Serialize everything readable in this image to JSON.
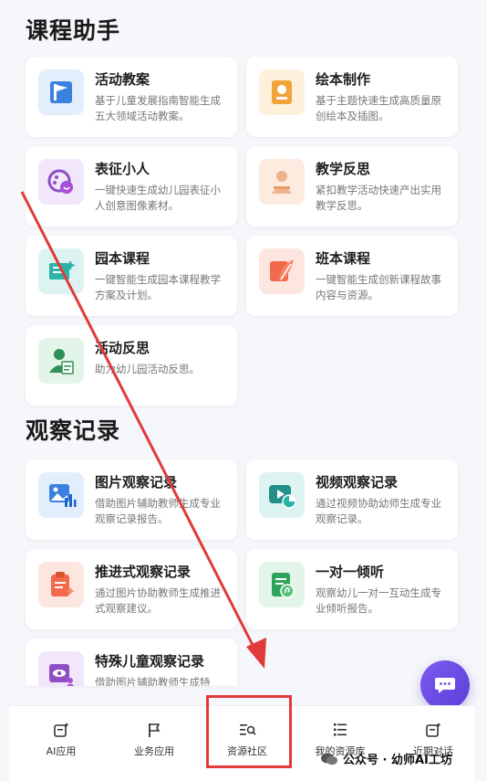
{
  "sections": {
    "course_assistant": "课程助手",
    "observation": "观察记录"
  },
  "course_cards": [
    {
      "title": "活动教案",
      "desc": "基于儿童发展指南智能生成五大领域活动教案。",
      "icon": "flag-book-icon"
    },
    {
      "title": "绘本制作",
      "desc": "基于主题快速生成高质量原创绘本及插图。",
      "icon": "picture-book-icon"
    },
    {
      "title": "表征小人",
      "desc": "一键快速生成幼儿园表征小人创意图像素材。",
      "icon": "palette-face-icon"
    },
    {
      "title": "教学反思",
      "desc": "紧扣教学活动快速产出实用教学反思。",
      "icon": "teacher-icon"
    },
    {
      "title": "园本课程",
      "desc": "一键智能生成园本课程教学方案及计划。",
      "icon": "chalkboard-icon"
    },
    {
      "title": "班本课程",
      "desc": "一键智能生成创新课程故事内容与资源。",
      "icon": "feather-icon"
    },
    {
      "title": "活动反思",
      "desc": "助力幼儿园活动反思。",
      "icon": "teacher-writing-icon"
    }
  ],
  "observation_cards": [
    {
      "title": "图片观察记录",
      "desc": "借助图片辅助教师生成专业观察记录报告。",
      "icon": "image-chart-icon"
    },
    {
      "title": "视频观察记录",
      "desc": "通过视频协助幼师生成专业观察记录。",
      "icon": "video-pie-icon"
    },
    {
      "title": "推进式观察记录",
      "desc": "通过图片协助教师生成推进式观察建议。",
      "icon": "clipboard-icon"
    },
    {
      "title": "一对一倾听",
      "desc": "观察幼儿一对一互动生成专业倾听报告。",
      "icon": "doc-ear-icon"
    },
    {
      "title": "特殊儿童观察记录",
      "desc": "借助图片辅助教师生成特",
      "icon": "eye-people-icon"
    }
  ],
  "tabs": [
    {
      "label": "AI应用",
      "icon": "ai-app-icon"
    },
    {
      "label": "业务应用",
      "icon": "flag-icon"
    },
    {
      "label": "资源社区",
      "icon": "search-list-icon"
    },
    {
      "label": "我的资源库",
      "icon": "list-icon"
    },
    {
      "label": "近期对话",
      "icon": "chat-history-icon"
    }
  ],
  "watermark": "公众号 · 幼师AI工坊",
  "colors": {
    "blue_bg": "#e3eefc",
    "orange_bg": "#fdf1dc",
    "purple_bg": "#f1e6fa",
    "peach_bg": "#fdebe0",
    "teal_bg": "#ddf3f1",
    "coral_bg": "#fde6e0",
    "green_bg": "#e3f4e8",
    "annotation_red": "#e03a3a",
    "fab_purple": "#6b4de6"
  }
}
